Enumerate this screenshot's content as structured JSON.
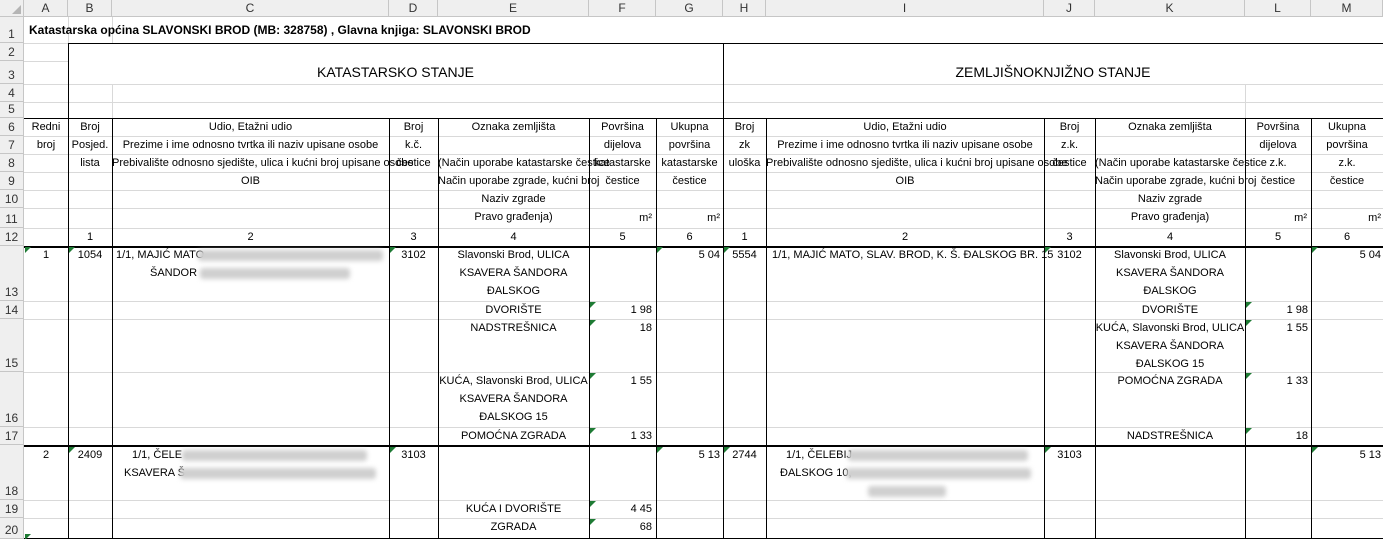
{
  "columns": [
    "A",
    "B",
    "C",
    "D",
    "E",
    "F",
    "G",
    "H",
    "I",
    "J",
    "K",
    "L",
    "M"
  ],
  "rows": [
    "1",
    "2",
    "3",
    "4",
    "5",
    "6",
    "7",
    "8",
    "9",
    "10",
    "11",
    "12",
    "13",
    "14",
    "15",
    "16",
    "17",
    "18",
    "19",
    "20"
  ],
  "title": "Katastarska općina SLAVONSKI BROD (MB: 328758) , Glavna knjiga: SLAVONSKI BROD",
  "section_left": "KATASTARSKO STANJE",
  "section_right": "ZEMLJIŠNOKNJIŽNO STANJE",
  "headers": {
    "redni": [
      "Redni",
      "broj"
    ],
    "broj_posjed": [
      "Broj",
      "Posjed.",
      "lista"
    ],
    "udio": [
      "Udio, Etažni udio",
      "Prezime i ime odnosno tvrtka ili naziv upisane osobe",
      "Prebivalište odnosno sjedište, ulica i kućni broj upisane osobe",
      "OIB"
    ],
    "broj_kc": [
      "Broj",
      "k.č.",
      "čestice"
    ],
    "oznaka": [
      "Oznaka zemljišta",
      "",
      "(Način uporabe katastarske čestice",
      "Način uporabe zgrade, kućni broj",
      "Naziv zgrade",
      "Pravo građenja)"
    ],
    "povrsina": [
      "Površina",
      "dijelova",
      "katastarske",
      "čestice",
      "m²"
    ],
    "ukupna": [
      "Ukupna",
      "površina",
      "katastarske",
      "čestice",
      "m²"
    ],
    "broj_zk": [
      "Broj",
      "zk",
      "uloška"
    ],
    "broj_zkc": [
      "Broj",
      "z.k.",
      "čestice"
    ],
    "povrsina_zk": [
      "Površina",
      "dijelova",
      "z.k.",
      "čestice",
      "m²"
    ],
    "ukupna_zk": [
      "Ukupna",
      "površina",
      "z.k.",
      "čestice",
      "m²"
    ]
  },
  "col_numbers": [
    "1",
    "2",
    "3",
    "4",
    "5",
    "6",
    "1",
    "2",
    "3",
    "4",
    "5",
    "6"
  ],
  "records": {
    "r1": {
      "redni": "1",
      "posjed": "1054",
      "owner_l1": "1/1, MAJIĆ MATO",
      "owner_l2": "ŠANDOR",
      "kc": "3102",
      "oznaka": [
        "Slavonski Brod, ULICA",
        "KSAVERA ŠANDORA",
        "ĐALSKOG"
      ],
      "ukupna": "5 04",
      "zk": "5554",
      "owner_zk": "1/1, MAJIĆ MATO, SLAV. BROD, K. Š. ĐALSKOG BR. 15",
      "zkc": "3102",
      "oznaka_zk": [
        "Slavonski Brod, ULICA",
        "KSAVERA ŠANDORA",
        "ĐALSKOG"
      ],
      "ukupna_zk": "5 04",
      "parts": [
        {
          "name": "DVORIŠTE",
          "area": "1 98"
        },
        {
          "name": "NADSTREŠNICA",
          "area": "18"
        },
        {
          "name": "KUĆA, Slavonski Brod, ULICA",
          "name2": "KSAVERA ŠANDORA",
          "name3": "ĐALSKOG 15",
          "area": "1 55"
        },
        {
          "name": "POMOĆNA ZGRADA",
          "area": "1 33"
        }
      ],
      "parts_zk": [
        {
          "name": "DVORIŠTE",
          "area": "1 98"
        },
        {
          "name": "KUĆA, Slavonski Brod, ULICA",
          "name2": "KSAVERA ŠANDORA",
          "name3": "ĐALSKOG 15",
          "area": "1 55"
        },
        {
          "name": "POMOĆNA ZGRADA",
          "area": "1 33"
        },
        {
          "name": "NADSTREŠNICA",
          "area": "18"
        }
      ]
    },
    "r2": {
      "redni": "2",
      "posjed": "2409",
      "owner_l1": "1/1, ČELE",
      "owner_l2": "KSAVERA Š",
      "kc": "3103",
      "ukupna": "5 13",
      "zk": "2744",
      "owner_zk_l1": "1/1, ČELEBIJ",
      "owner_zk_l2": "ĐALSKOG 10,",
      "zkc": "3103",
      "ukupna_zk": "5 13",
      "parts": [
        {
          "name": "KUĆA I DVORIŠTE",
          "area": "4 45"
        },
        {
          "name": "ZGRADA",
          "area": "68"
        }
      ]
    }
  }
}
